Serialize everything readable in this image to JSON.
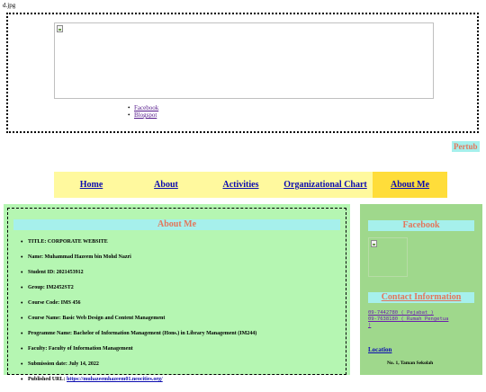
{
  "file": {
    "name": "d.jpg"
  },
  "header": {
    "social_links": [
      "Facebook",
      "Blogspot"
    ]
  },
  "marquee": {
    "text": "Pertub"
  },
  "nav": {
    "items": [
      "Home",
      "About",
      "Activities",
      "Organizational Chart",
      "About Me"
    ],
    "active": "About Me"
  },
  "about": {
    "title": "About Me",
    "items": [
      "TITLE: CORPORATE WEBSITE",
      "Name: Muhammad Hazeem bin Mohd Nazri",
      "Student ID: 2021453912",
      "Group: IM2452ST2",
      "Course Code: IMS 456",
      "Course Name: Basic Web Design and Content Management",
      "Programme Name: Bachelor of Information Management (Hons.) in Library Management (IM244)",
      "Faculty: Faculty of Information Management",
      "Submission date: July 14, 2022"
    ],
    "url_label": "Published URL:",
    "url_value": "https://muhazeemhazeem01.neocities.org/"
  },
  "side": {
    "facebook_title": "Facebook",
    "contact_title": "Contact Information",
    "phones": [
      "09-7442780 ( Pejabat )",
      "09-7638180 ( Rumah Pengetua",
      ")"
    ],
    "location_label": "Location",
    "address_line": "No. 1, Taman Sekolah"
  },
  "colors": {
    "main_bg": "#b5f6b2",
    "side_bg": "#9fd88c",
    "nav_bg": "#fff99e",
    "nav_active_bg": "#ffdd3a",
    "heading_bg": "#a6f0ec",
    "heading_text": "#e2765b",
    "link": "#0b0bb0"
  }
}
